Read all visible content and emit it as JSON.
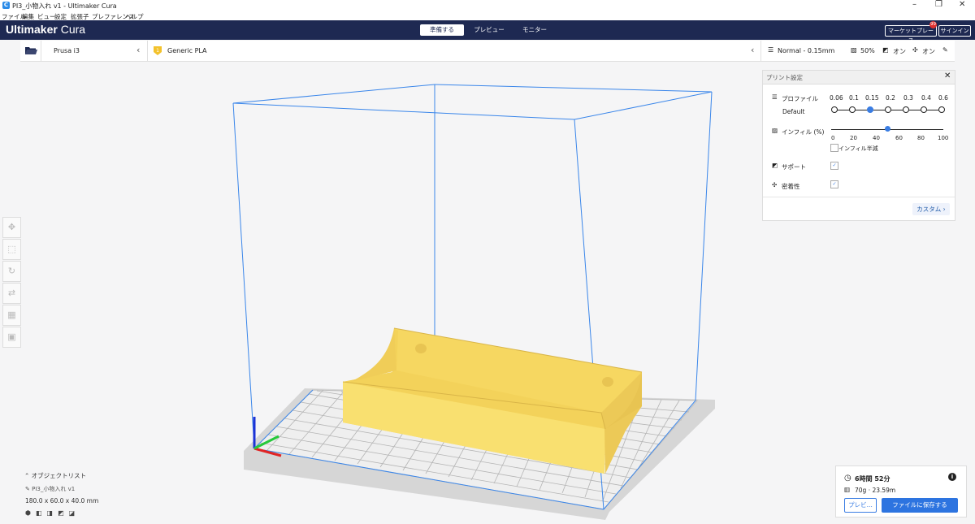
{
  "window": {
    "title": "PI3_小物入れ v1 - Ultimaker Cura",
    "controls": [
      "–",
      "❐",
      "✕"
    ]
  },
  "menu": [
    "ファイル",
    "編集",
    "ビュー",
    "設定",
    "拡張子",
    "プレファレンス",
    "ヘルプ"
  ],
  "header": {
    "logo_bold": "Ultimaker",
    "logo_light": "Cura",
    "stages": [
      "準備する",
      "プレビュー",
      "モニター"
    ],
    "active_stage": "準備する",
    "marketplace_label": "マーケットプレース",
    "marketplace_badge": "99",
    "signin_label": "サインイン"
  },
  "toolbar": {
    "printer": "Prusa i3",
    "material": "Generic PLA",
    "profile_summary": "Normal - 0.15mm",
    "infill_summary": "50%",
    "support_summary": "オン",
    "adhesion_summary": "オン"
  },
  "print_settings": {
    "title": "プリント設定",
    "profile_label": "プロファイル",
    "profile_name": "Default",
    "layer_heights": [
      "0.06",
      "0.1",
      "0.15",
      "0.2",
      "0.3",
      "0.4",
      "0.6"
    ],
    "selected_layer_height": "0.15",
    "infill_label": "インフィル (%)",
    "infill_ticks": [
      "0",
      "20",
      "40",
      "60",
      "80",
      "100"
    ],
    "infill_value_percent": 50,
    "gradual_infill_label": "インフィル半減",
    "support_label": "サポート",
    "adhesion_label": "密着性",
    "custom_button": "カスタム"
  },
  "object_list": {
    "header": "オブジェクトリスト",
    "object_name": "PI3_小物入れ v1",
    "dimensions": "180.0 x 60.0 x 40.0 mm"
  },
  "summary": {
    "time": "6時間 52分",
    "material": "70g · 23.59m",
    "preview_button": "プレビ...",
    "save_button": "ファイルに保存する"
  }
}
